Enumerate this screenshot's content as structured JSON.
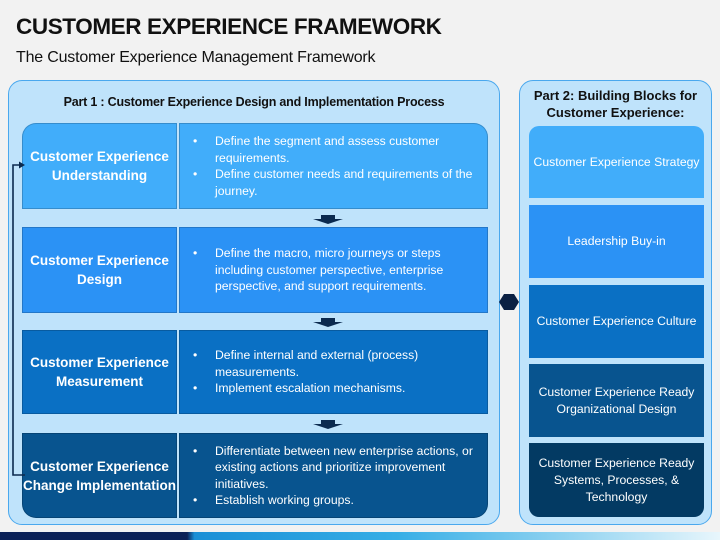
{
  "header": {
    "title": "CUSTOMER EXPERIENCE FRAMEWORK",
    "subtitle": "The Customer Experience Management Framework"
  },
  "part1": {
    "title": "Part 1 : Customer Experience Design and Implementation Process",
    "steps": [
      {
        "label": "Customer Experience Understanding",
        "bullets": [
          "Define the segment and assess customer requirements.",
          "Define customer needs and requirements of the journey."
        ]
      },
      {
        "label": "Customer Experience Design",
        "bullets": [
          "Define the macro, micro journeys or steps including customer perspective, enterprise perspective, and support requirements."
        ]
      },
      {
        "label": "Customer Experience Measurement",
        "bullets": [
          "Define internal and external (process) measurements.",
          "Implement escalation mechanisms."
        ]
      },
      {
        "label": "Customer Experience Change Implementation",
        "bullets": [
          "Differentiate between new enterprise actions, or existing actions and prioritize improvement initiatives.",
          "Establish working groups."
        ]
      }
    ]
  },
  "part2": {
    "title": "Part 2: Building Blocks for Customer Experience:",
    "blocks": [
      "Customer Experience Strategy",
      "Leadership Buy-in",
      "Customer Experience Culture",
      "Customer Experience Ready Organizational Design",
      "Customer Experience Ready Systems, Processes, & Technology"
    ]
  },
  "bullet_glyph": "•",
  "colors": {
    "panel_bg": "#bfe3fb",
    "panel_border": "#4aa8ee",
    "step1": "#41adfa",
    "step2": "#2b92f5",
    "step3": "#0a70c4",
    "step4": "#08548f",
    "block5": "#033a63",
    "arrow": "#0b2a4f"
  }
}
